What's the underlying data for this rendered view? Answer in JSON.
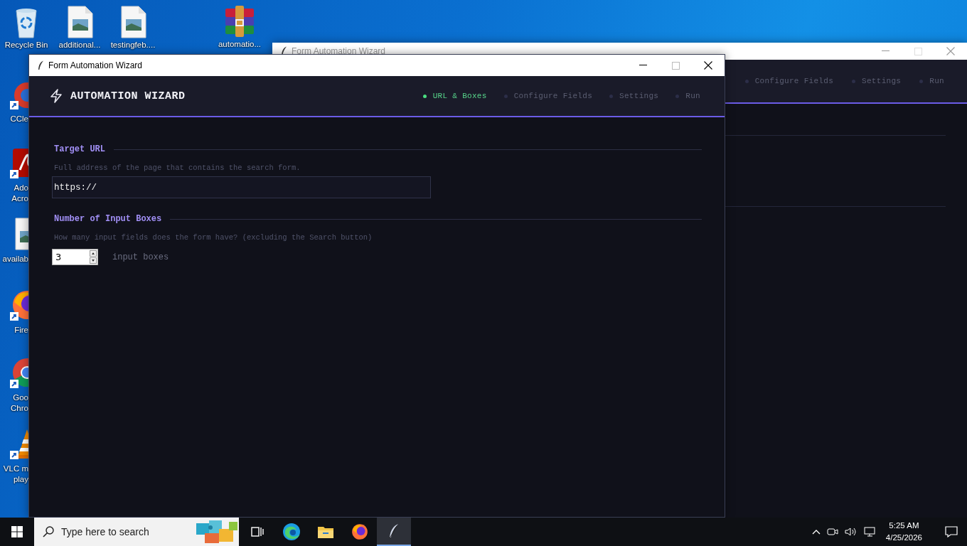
{
  "desktop_icons": [
    {
      "kind": "recycle",
      "lines": [
        "Recycle Bin"
      ],
      "shortcut": false
    },
    {
      "kind": "image-file",
      "lines": [
        "additional..."
      ],
      "shortcut": false
    },
    {
      "kind": "image-file",
      "lines": [
        "testingfeb...."
      ],
      "shortcut": false
    },
    {
      "kind": "archive",
      "lines": [
        "automatio..."
      ],
      "shortcut": false
    },
    {
      "kind": "brush",
      "lines": [
        "CCle"
      ],
      "shortcut": true
    },
    {
      "kind": "pdf",
      "lines": [
        "Ado",
        "Acro"
      ],
      "shortcut": true
    },
    {
      "kind": "image-file",
      "lines": [
        "availab"
      ],
      "shortcut": false
    },
    {
      "kind": "fox",
      "lines": [
        "Fire"
      ],
      "shortcut": true
    },
    {
      "kind": "ring",
      "lines": [
        "Goo",
        "Chro"
      ],
      "shortcut": true
    },
    {
      "kind": "cone",
      "lines": [
        "VLC m",
        "play"
      ],
      "shortcut": true
    }
  ],
  "background_window": {
    "title": "Form Automation Wizard",
    "steps": [
      {
        "label": "Configure Fields",
        "selected": false
      },
      {
        "label": "Settings",
        "selected": false
      },
      {
        "label": "Run",
        "selected": false
      }
    ]
  },
  "window": {
    "title": "Form Automation Wizard",
    "app_title": "AUTOMATION WIZARD",
    "steps": [
      {
        "label": "URL & Boxes",
        "selected": true
      },
      {
        "label": "Configure Fields",
        "selected": false
      },
      {
        "label": "Settings",
        "selected": false
      },
      {
        "label": "Run",
        "selected": false
      }
    ],
    "sections": [
      {
        "kind": "text",
        "title": "Target URL",
        "hint": "Full address of the page that contains the search form.",
        "value": "https://"
      },
      {
        "kind": "spinner",
        "title": "Number of Input Boxes",
        "hint": "How many input fields does the form have? (excluding the Search button)",
        "value": "3",
        "unit": "input boxes"
      }
    ]
  },
  "taskbar": {
    "search": {
      "placeholder": "Type here to search"
    },
    "apps": [
      {
        "kind": "task-view",
        "selected": false
      },
      {
        "kind": "edge",
        "selected": false
      },
      {
        "kind": "folder",
        "selected": false
      },
      {
        "kind": "fox",
        "selected": false
      },
      {
        "kind": "feather",
        "selected": true
      }
    ],
    "time": "5:25 AM",
    "date": "4/25/2026"
  }
}
